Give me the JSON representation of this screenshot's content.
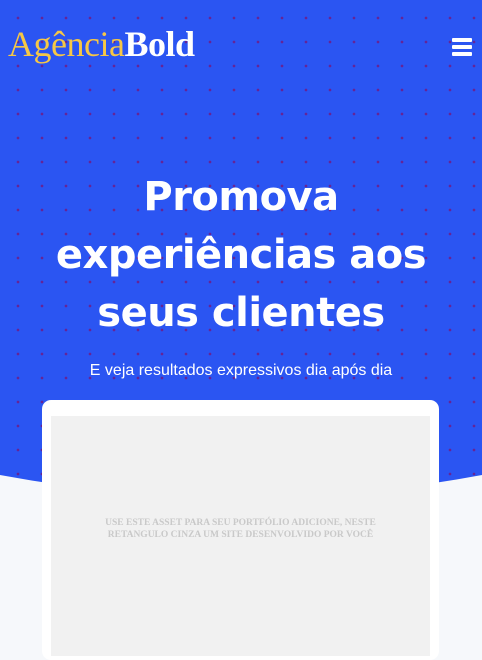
{
  "header": {
    "logo": {
      "part1": "Agência",
      "part2": "Bold"
    },
    "menu_icon": "hamburger-menu-icon"
  },
  "hero": {
    "title_lines": [
      "Promova",
      "experiências aos",
      "seus clientes"
    ],
    "subtitle": "E veja resultados expressivos dia após dia"
  },
  "mockup": {
    "placeholder_lines": [
      "USE ESTE ASSET PARA SEU PORTFÓLIO ADICIONE, NESTE",
      "RETANGULO CINZA UM SITE DESENVOLVIDO POR VOCÊ"
    ]
  },
  "colors": {
    "hero_bg": "#2b55f2",
    "logo_accent": "#f6c746",
    "text": "#ffffff",
    "page_bg": "#f6f8fb",
    "screen_bg": "#f1f1f1"
  }
}
